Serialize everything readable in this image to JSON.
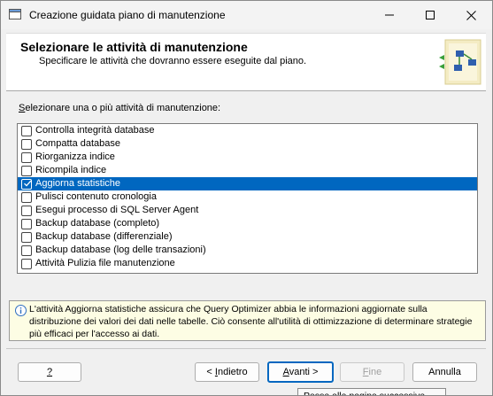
{
  "window": {
    "title": "Creazione guidata piano di manutenzione"
  },
  "header": {
    "title": "Selezionare le attività di manutenzione",
    "subtitle": "Specificare le attività che dovranno essere eseguite dal piano."
  },
  "list_label_prefix": "S",
  "list_label_rest": "elezionare una o più attività di manutenzione:",
  "tasks": [
    {
      "label": "Controlla integrità database",
      "checked": false,
      "selected": false
    },
    {
      "label": "Compatta database",
      "checked": false,
      "selected": false
    },
    {
      "label": "Riorganizza indice",
      "checked": false,
      "selected": false
    },
    {
      "label": "Ricompila indice",
      "checked": false,
      "selected": false
    },
    {
      "label": "Aggiorna statistiche",
      "checked": true,
      "selected": true
    },
    {
      "label": "Pulisci contenuto cronologia",
      "checked": false,
      "selected": false
    },
    {
      "label": "Esegui processo di SQL Server Agent",
      "checked": false,
      "selected": false
    },
    {
      "label": "Backup database (completo)",
      "checked": false,
      "selected": false
    },
    {
      "label": "Backup database (differenziale)",
      "checked": false,
      "selected": false
    },
    {
      "label": "Backup database (log delle transazioni)",
      "checked": false,
      "selected": false
    },
    {
      "label": "Attività Pulizia file manutenzione",
      "checked": false,
      "selected": false
    }
  ],
  "info": {
    "text": "L'attività Aggiorna statistiche assicura che Query Optimizer abbia le informazioni aggiornate sulla distribuzione dei valori dei dati nelle tabelle. Ciò consente all'utilità di ottimizzazione di determinare strategie più efficaci per l'accesso ai dati."
  },
  "buttons": {
    "help": "?",
    "back_prefix": "< ",
    "back_key": "I",
    "back_rest": "ndietro",
    "next_key": "A",
    "next_rest": "vanti >",
    "finish_key": "F",
    "finish_rest": "ine",
    "cancel": "Annulla"
  },
  "tooltip": "Passa alla pagina successiva",
  "colors": {
    "selection": "#0067c0",
    "info_background": "#fdfde4"
  }
}
